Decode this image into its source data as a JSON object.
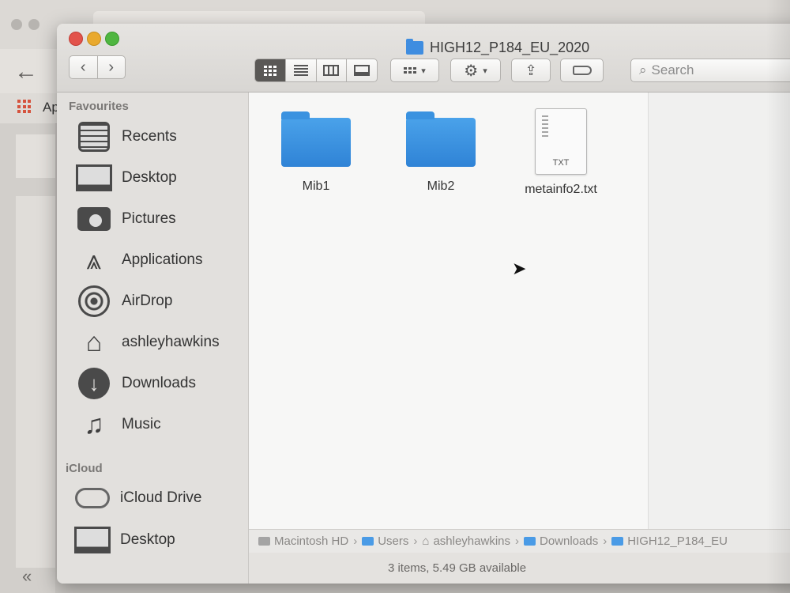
{
  "browser": {
    "back_icon": "arrow-left-icon",
    "apps_label": "Ap"
  },
  "finder": {
    "title": "HIGH12_P184_EU_2020",
    "search_placeholder": "Search",
    "view_modes": [
      "icon-view",
      "list-view",
      "column-view",
      "gallery-view"
    ],
    "active_view": "icon-view"
  },
  "sidebar": {
    "favourites_header": "Favourites",
    "favourites": [
      {
        "label": "Recents",
        "icon": "recents-icon"
      },
      {
        "label": "Desktop",
        "icon": "desktop-icon"
      },
      {
        "label": "Pictures",
        "icon": "camera-icon"
      },
      {
        "label": "Applications",
        "icon": "applications-icon"
      },
      {
        "label": "AirDrop",
        "icon": "airdrop-icon"
      },
      {
        "label": "ashleyhawkins",
        "icon": "home-icon"
      },
      {
        "label": "Downloads",
        "icon": "download-icon"
      },
      {
        "label": "Music",
        "icon": "music-icon"
      }
    ],
    "icloud_header": "iCloud",
    "icloud": [
      {
        "label": "iCloud Drive",
        "icon": "cloud-icon"
      },
      {
        "label": "Desktop",
        "icon": "desktop-icon"
      }
    ]
  },
  "files": [
    {
      "name": "Mib1",
      "kind": "folder"
    },
    {
      "name": "Mib2",
      "kind": "folder"
    },
    {
      "name": "metainfo2.txt",
      "kind": "text",
      "ext": "TXT"
    }
  ],
  "pathbar": [
    "Macintosh HD",
    "Users",
    "ashleyhawkins",
    "Downloads",
    "HIGH12_P184_EU"
  ],
  "status": "3 items, 5.49 GB available"
}
